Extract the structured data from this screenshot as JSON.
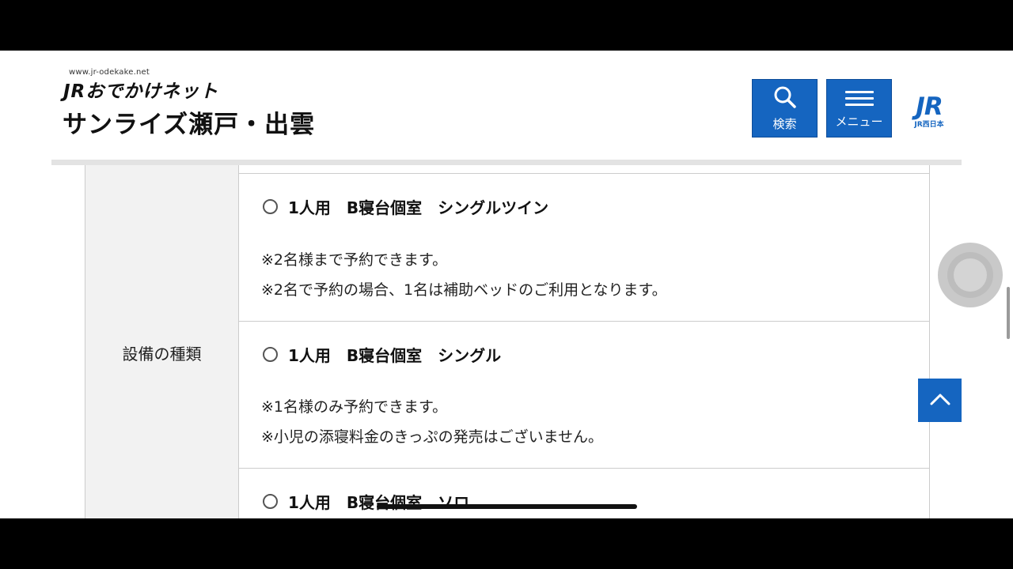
{
  "header": {
    "site_url": "www.jr-odekake.net",
    "logo_text": "JRおでかけネット",
    "page_title": "サンライズ瀬戸・出雲",
    "search_label": "検索",
    "menu_label": "メニュー",
    "jr_logo_big": "JR",
    "jr_logo_small": "JR西日本"
  },
  "table": {
    "row_label": "設備の種類",
    "options": [
      {
        "name": "1人用　B寝台個室　シングルツイン",
        "notes": [
          "※2名様まで予約できます。",
          "※2名で予約の場合、1名は補助ベッドのご利用となります。"
        ]
      },
      {
        "name": "1人用　B寝台個室　シングル",
        "notes": [
          "※1名様のみ予約できます。",
          "※小児の添寝料金のきっぷの発売はございません。"
        ]
      },
      {
        "name": "1人用　B寝台個室　ソロ",
        "notes": []
      }
    ]
  },
  "colors": {
    "accent": "#1565c0",
    "background": "#ffffff",
    "label_bg": "#f2f2f2",
    "border": "#cccccc"
  },
  "icons": {
    "search": "search-icon",
    "menu": "hamburger-icon",
    "to_top": "chevron-up-icon",
    "radio": "radio-icon"
  }
}
